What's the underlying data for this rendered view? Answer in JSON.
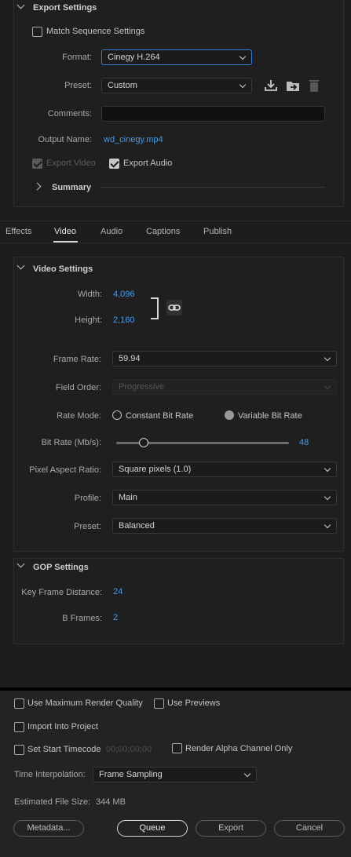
{
  "export_settings": {
    "title": "Export Settings",
    "match_sequence_label": "Match Sequence Settings",
    "format_label": "Format:",
    "format_value": "Cinegy H.264",
    "preset_label": "Preset:",
    "preset_value": "Custom",
    "comments_label": "Comments:",
    "comments_value": "",
    "output_name_label": "Output Name:",
    "output_name_value": "wd_cinegy.mp4",
    "export_video_label": "Export Video",
    "export_audio_label": "Export Audio",
    "summary_label": "Summary"
  },
  "tabs": [
    {
      "label": "Effects",
      "active": false
    },
    {
      "label": "Video",
      "active": true
    },
    {
      "label": "Audio",
      "active": false
    },
    {
      "label": "Captions",
      "active": false
    },
    {
      "label": "Publish",
      "active": false
    }
  ],
  "video_settings": {
    "title": "Video Settings",
    "width_label": "Width:",
    "width_value": "4,096",
    "height_label": "Height:",
    "height_value": "2,160",
    "frame_rate_label": "Frame Rate:",
    "frame_rate_value": "59.94",
    "field_order_label": "Field Order:",
    "field_order_value": "Progressive",
    "rate_mode_label": "Rate Mode:",
    "rate_mode_option1": "Constant Bit Rate",
    "rate_mode_option2": "Variable Bit Rate",
    "bit_rate_label": "Bit Rate (Mb/s):",
    "bit_rate_value": "48",
    "bit_rate_fraction": 0.16,
    "par_label": "Pixel Aspect Ratio:",
    "par_value": "Square pixels (1.0)",
    "profile_label": "Profile:",
    "profile_value": "Main",
    "preset_label": "Preset:",
    "preset_value": "Balanced"
  },
  "gop_settings": {
    "title": "GOP Settings",
    "key_frame_label": "Key Frame Distance:",
    "key_frame_value": "24",
    "b_frames_label": "B Frames:",
    "b_frames_value": "2"
  },
  "bottom": {
    "max_render_label": "Use Maximum Render Quality",
    "use_previews_label": "Use Previews",
    "import_label": "Import Into Project",
    "start_tc_label": "Set Start Timecode",
    "start_tc_value": "00;00;00;00",
    "alpha_label": "Render Alpha Channel Only",
    "time_interp_label": "Time Interpolation:",
    "time_interp_value": "Frame Sampling",
    "file_size_label": "Estimated File Size:",
    "file_size_value": "344 MB",
    "metadata_btn": "Metadata...",
    "queue_btn": "Queue",
    "export_btn": "Export",
    "cancel_btn": "Cancel"
  }
}
